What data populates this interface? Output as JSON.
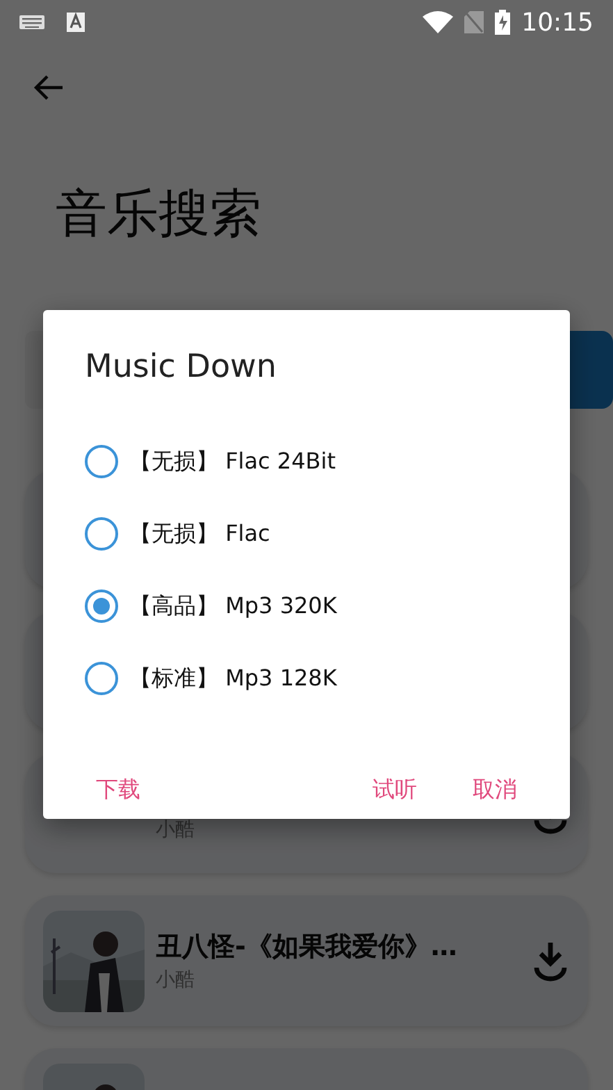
{
  "status_bar": {
    "time": "10:15"
  },
  "page": {
    "title": "音乐搜索"
  },
  "songs": [
    {
      "kind": "blank"
    },
    {
      "kind": "blank"
    },
    {
      "kind": "text",
      "subtitle": "小酷"
    },
    {
      "kind": "picture",
      "title": "丑八怪-《如果我爱你》…",
      "subtitle": "小酷"
    },
    {
      "kind": "picture"
    }
  ],
  "dialog": {
    "title": "Music Down",
    "options": [
      {
        "tag": "【无损】",
        "label": "Flac 24Bit",
        "selected": false
      },
      {
        "tag": "【无损】",
        "label": "Flac",
        "selected": false
      },
      {
        "tag": "【高品】",
        "label": "Mp3 320K",
        "selected": true
      },
      {
        "tag": "【标准】",
        "label": "Mp3 128K",
        "selected": false
      }
    ],
    "buttons": [
      {
        "label": "下载"
      },
      {
        "label": "试听"
      },
      {
        "label": "取消"
      }
    ]
  }
}
